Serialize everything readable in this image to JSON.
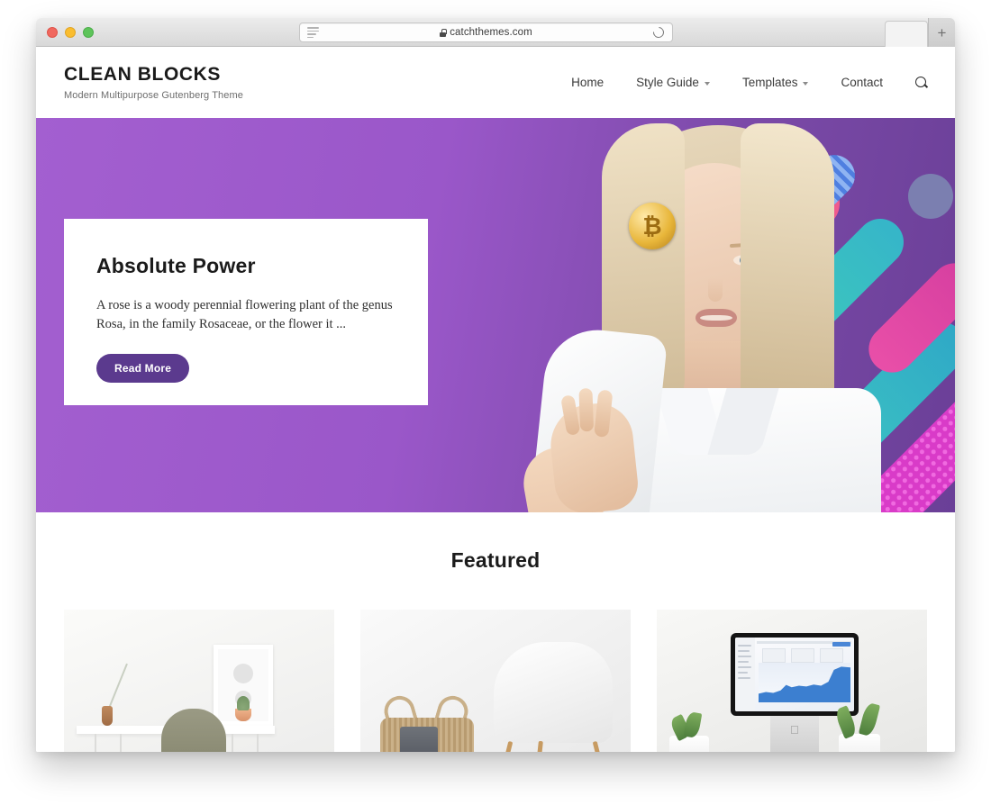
{
  "browser": {
    "url": "catchthemes.com",
    "lock_icon": "lock-icon",
    "reader_icon": "reader-view-icon",
    "reload_icon": "reload-icon",
    "newtab_label": "+",
    "traffic_lights": [
      "close-red",
      "minimize-yellow",
      "maximize-green"
    ]
  },
  "site": {
    "brand": {
      "title": "CLEAN BLOCKS",
      "tagline": "Modern Multipurpose Gutenberg Theme"
    },
    "nav": [
      {
        "label": "Home",
        "has_dropdown": false
      },
      {
        "label": "Style Guide",
        "has_dropdown": true
      },
      {
        "label": "Templates",
        "has_dropdown": true
      },
      {
        "label": "Contact",
        "has_dropdown": false
      }
    ],
    "search_icon": "search-icon"
  },
  "hero": {
    "heading": "Absolute Power",
    "description": "A rose is a woody perennial flowering plant of the genus Rosa, in the family Rosaceae, or the flower it ...",
    "button_label": "Read More",
    "button_color": "#5b3a8e",
    "background_color": "#a25fd0",
    "image_alt": "Blonde woman in white shirt holding a gold bitcoin coin over her eye against a purple background with colorful geometric shapes"
  },
  "featured": {
    "title": "Featured",
    "cards": [
      {
        "alt": "Minimal white desk with olive chair, dried branch in vase and framed picture"
      },
      {
        "alt": "White Eames-style chair beside a woven seagrass basket with grey throws"
      },
      {
        "alt": "iMac displaying a blue analytics chart on a desk with potted plants and keyboard"
      }
    ]
  },
  "colors": {
    "accent": "#5b3a8e",
    "hero_purple": "#a25fd0",
    "hero_purple_dark": "#6a3f97",
    "text_dark": "#1b1b1b",
    "text_muted": "#6d6d6d"
  }
}
